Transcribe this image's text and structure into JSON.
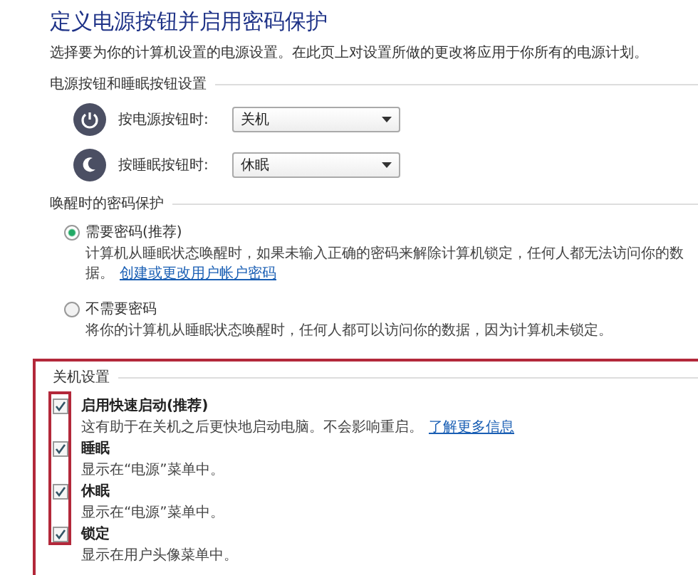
{
  "title": "定义电源按钮并启用密码保护",
  "description": "选择要为你的计算机设置的电源设置。在此页上对设置所做的更改将应用于你所有的电源计划。",
  "button_settings": {
    "heading": "电源按钮和睡眠按钮设置",
    "rows": [
      {
        "kind": "power",
        "label": "按电源按钮时:",
        "value": "关机"
      },
      {
        "kind": "sleep",
        "label": "按睡眠按钮时:",
        "value": "休眠"
      }
    ]
  },
  "wake_password": {
    "heading": "唤醒时的密码保护",
    "options": [
      {
        "label": "需要密码(推荐)",
        "selected": true,
        "description": "计算机从睡眠状态唤醒时，如果未输入正确的密码来解除计算机锁定，任何人都无法访问你的数据。",
        "link": "创建或更改用户帐户密码"
      },
      {
        "label": "不需要密码",
        "selected": false,
        "description": "将你的计算机从睡眠状态唤醒时，任何人都可以访问你的数据，因为计算机未锁定。"
      }
    ]
  },
  "shutdown_settings": {
    "heading": "关机设置",
    "highlighted": true,
    "items": [
      {
        "label": "启用快速启动(推荐)",
        "checked": true,
        "description": "这有助于在关机之后更快地启动电脑。不会影响重启。",
        "link": "了解更多信息"
      },
      {
        "label": "睡眠",
        "checked": true,
        "description": "显示在“电源”菜单中。"
      },
      {
        "label": "休眠",
        "checked": true,
        "description": "显示在“电源”菜单中。"
      },
      {
        "label": "锁定",
        "checked": true,
        "description": "显示在用户头像菜单中。"
      }
    ]
  }
}
